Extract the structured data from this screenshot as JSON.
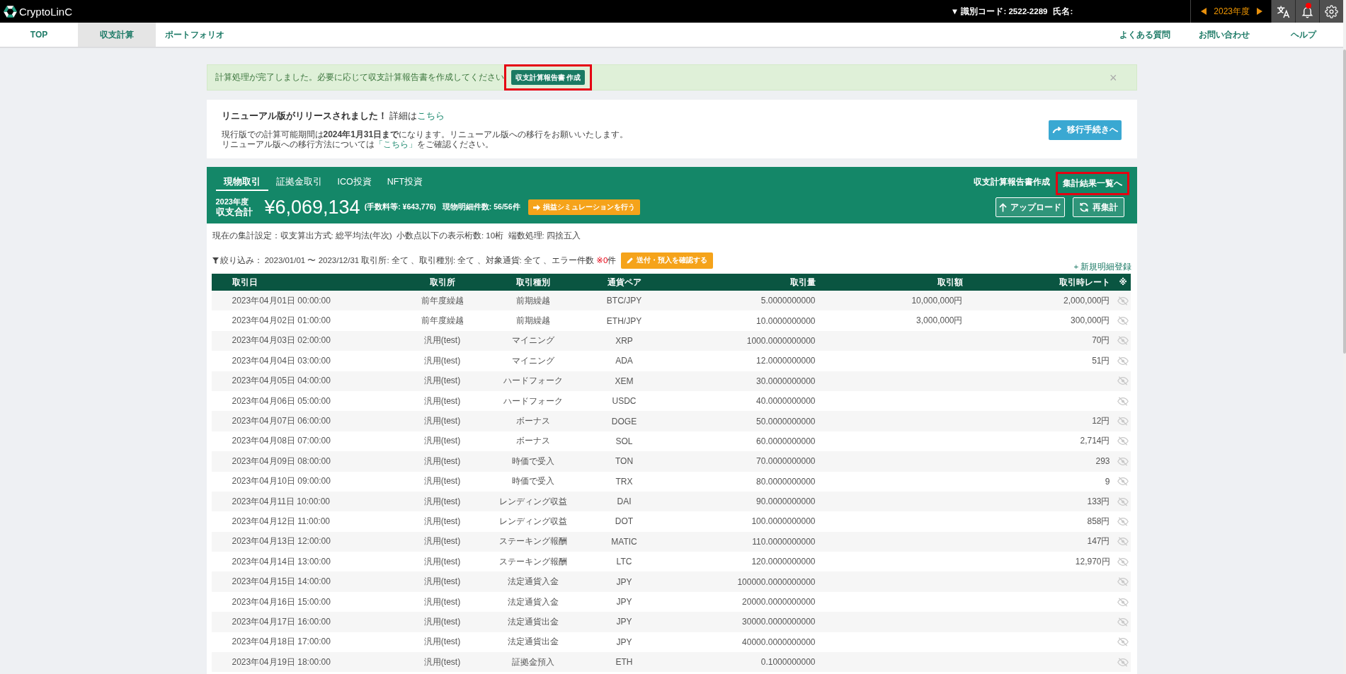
{
  "top_bar": {
    "brand": "CryptoLinC",
    "user_code": "▼ 識別コード: 2522-2289",
    "user_name_label": "氏名:",
    "fiscal_year": "2023年度",
    "notification_unread": true
  },
  "nav": {
    "tabs": [
      {
        "label": "TOP",
        "selected": false
      },
      {
        "label": "収支計算",
        "selected": true
      },
      {
        "label": "ポートフォリオ",
        "selected": false
      }
    ],
    "links": [
      "よくある質問",
      "お問い合わせ",
      "ヘルプ"
    ]
  },
  "alert": {
    "message": "計算処理が完了しました。必要に応じて収支計算報告書を作成してください",
    "button": {
      "label": "収支計算報告書 作成",
      "highlighted": true
    },
    "close": "×"
  },
  "announcement": {
    "title": "リニューアル版がリリースされました！",
    "detail_prefix": "詳細は",
    "detail_link": "こちら",
    "line_1": "現行版での計算可能期間は**2024年1月31日まで**になります。リニューアル版への移行をお願いいたします。",
    "line_2_before": "リニューアル版への移行方法については",
    "line_2_link": "「こちら」",
    "line_2_after": "をご確認ください。",
    "button": "移行手続きへ"
  },
  "panel": {
    "tabs": [
      {
        "label": "現物取引",
        "selected": true
      },
      {
        "label": "証拠金取引",
        "selected": false
      },
      {
        "label": "ICO投資",
        "selected": false
      },
      {
        "label": "NFT投資",
        "selected": false
      }
    ],
    "report_link": "収支計算報告書作成",
    "results_link": {
      "label": "集計結果一覧へ",
      "highlighted": true
    },
    "year_label": "2023年度",
    "total_label": "収支合計",
    "total": "¥6,069,134",
    "fees": "(手数料等: ¥643,776)",
    "detail_count": "現物明細件数: 56/56件",
    "simulate_button": "損益シミュレーションを行う",
    "upload_button": "アップロード",
    "recalc_button": "再集計"
  },
  "settings": "現在の集計設定：収支算出方式: 総平均法(年次)  小数点以下の表示桁数: 10桁  端数処理: 四捨五入",
  "filter": {
    "label": "絞り込み：",
    "summary": "2023/01/01 〜 2023/12/31 取引所: 全て 、取引種別: 全て 、対象通貨: 全て 、エラー件数",
    "error_count": "※0",
    "error_unit": "件",
    "confirm_button": "送付・預入を確認する"
  },
  "new_entry_link": "+ 新規明細登録",
  "table": {
    "columns": [
      "取引日",
      "取引所",
      "取引種別",
      "通貨ペア",
      "取引量",
      "取引額",
      "取引時レート",
      "※"
    ],
    "rows": [
      {
        "date": "2023年04月01日 00:00:00",
        "exchange": "前年度繰越",
        "type": "前期繰越",
        "pair": "BTC/JPY",
        "amount": "5.0000000000",
        "value": "10,000,000円",
        "rate": "2,000,000円"
      },
      {
        "date": "2023年04月02日 01:00:00",
        "exchange": "前年度繰越",
        "type": "前期繰越",
        "pair": "ETH/JPY",
        "amount": "10.0000000000",
        "value": "3,000,000円",
        "rate": "300,000円"
      },
      {
        "date": "2023年04月03日 02:00:00",
        "exchange": "汎用(test)",
        "type": "マイニング",
        "pair": "XRP",
        "amount": "1000.0000000000",
        "rate": "70円"
      },
      {
        "date": "2023年04月04日 03:00:00",
        "exchange": "汎用(test)",
        "type": "マイニング",
        "pair": "ADA",
        "amount": "12.0000000000",
        "rate": "51円"
      },
      {
        "date": "2023年04月05日 04:00:00",
        "exchange": "汎用(test)",
        "type": "ハードフォーク",
        "pair": "XEM",
        "amount": "30.0000000000"
      },
      {
        "date": "2023年04月06日 05:00:00",
        "exchange": "汎用(test)",
        "type": "ハードフォーク",
        "pair": "USDC",
        "amount": "40.0000000000"
      },
      {
        "date": "2023年04月07日 06:00:00",
        "exchange": "汎用(test)",
        "type": "ボーナス",
        "pair": "DOGE",
        "amount": "50.0000000000",
        "rate": "12円"
      },
      {
        "date": "2023年04月08日 07:00:00",
        "exchange": "汎用(test)",
        "type": "ボーナス",
        "pair": "SOL",
        "amount": "60.0000000000",
        "rate": "2,714円"
      },
      {
        "date": "2023年04月09日 08:00:00",
        "exchange": "汎用(test)",
        "type": "時価で受入",
        "pair": "TON",
        "amount": "70.0000000000",
        "rate": "293"
      },
      {
        "date": "2023年04月10日 09:00:00",
        "exchange": "汎用(test)",
        "type": "時価で受入",
        "pair": "TRX",
        "amount": "80.0000000000",
        "rate": "9"
      },
      {
        "date": "2023年04月11日 10:00:00",
        "exchange": "汎用(test)",
        "type": "レンディング収益",
        "pair": "DAI",
        "amount": "90.0000000000",
        "rate": "133円"
      },
      {
        "date": "2023年04月12日 11:00:00",
        "exchange": "汎用(test)",
        "type": "レンディング収益",
        "pair": "DOT",
        "amount": "100.0000000000",
        "rate": "858円"
      },
      {
        "date": "2023年04月13日 12:00:00",
        "exchange": "汎用(test)",
        "type": "ステーキング報酬",
        "pair": "MATIC",
        "amount": "110.0000000000",
        "rate": "147円"
      },
      {
        "date": "2023年04月14日 13:00:00",
        "exchange": "汎用(test)",
        "type": "ステーキング報酬",
        "pair": "LTC",
        "amount": "120.0000000000",
        "rate": "12,970円"
      },
      {
        "date": "2023年04月15日 14:00:00",
        "exchange": "汎用(test)",
        "type": "法定通貨入金",
        "pair": "JPY",
        "amount": "100000.0000000000"
      },
      {
        "date": "2023年04月16日 15:00:00",
        "exchange": "汎用(test)",
        "type": "法定通貨入金",
        "pair": "JPY",
        "amount": "20000.0000000000"
      },
      {
        "date": "2023年04月17日 16:00:00",
        "exchange": "汎用(test)",
        "type": "法定通貨出金",
        "pair": "JPY",
        "amount": "30000.0000000000"
      },
      {
        "date": "2023年04月18日 17:00:00",
        "exchange": "汎用(test)",
        "type": "法定通貨出金",
        "pair": "JPY",
        "amount": "40000.0000000000"
      },
      {
        "date": "2023年04月19日 18:00:00",
        "exchange": "汎用(test)",
        "type": "証拠金預入",
        "pair": "ETH",
        "amount": "0.1000000000"
      }
    ]
  }
}
